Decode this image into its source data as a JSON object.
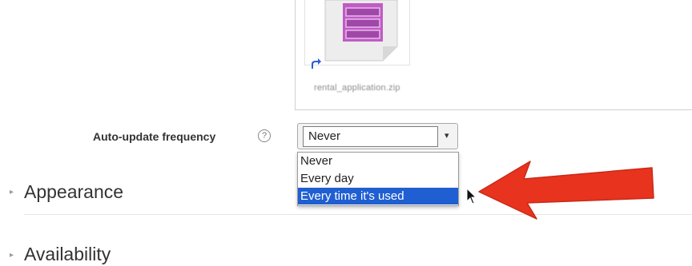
{
  "file_picker": {
    "filename": "rental_application.zip",
    "file_icon": "zip-archive-icon",
    "shortcut_icon": "alias-arrow-icon"
  },
  "auto_update": {
    "label": "Auto-update frequency",
    "help_icon": "help-icon",
    "help_glyph": "?",
    "selected_value": "Never",
    "options": [
      {
        "label": "Never",
        "highlighted": false
      },
      {
        "label": "Every day",
        "highlighted": false
      },
      {
        "label": "Every time it's used",
        "highlighted": true
      }
    ]
  },
  "sections": {
    "appearance": {
      "title": "Appearance",
      "toggle_glyph": "▸"
    },
    "availability": {
      "title": "Availability",
      "toggle_glyph": "▸"
    }
  },
  "annotation": {
    "arrow_color": "#e8331f",
    "arrow_icon": "red-pointer-arrow"
  },
  "colors": {
    "highlight": "#1f5fd1"
  }
}
